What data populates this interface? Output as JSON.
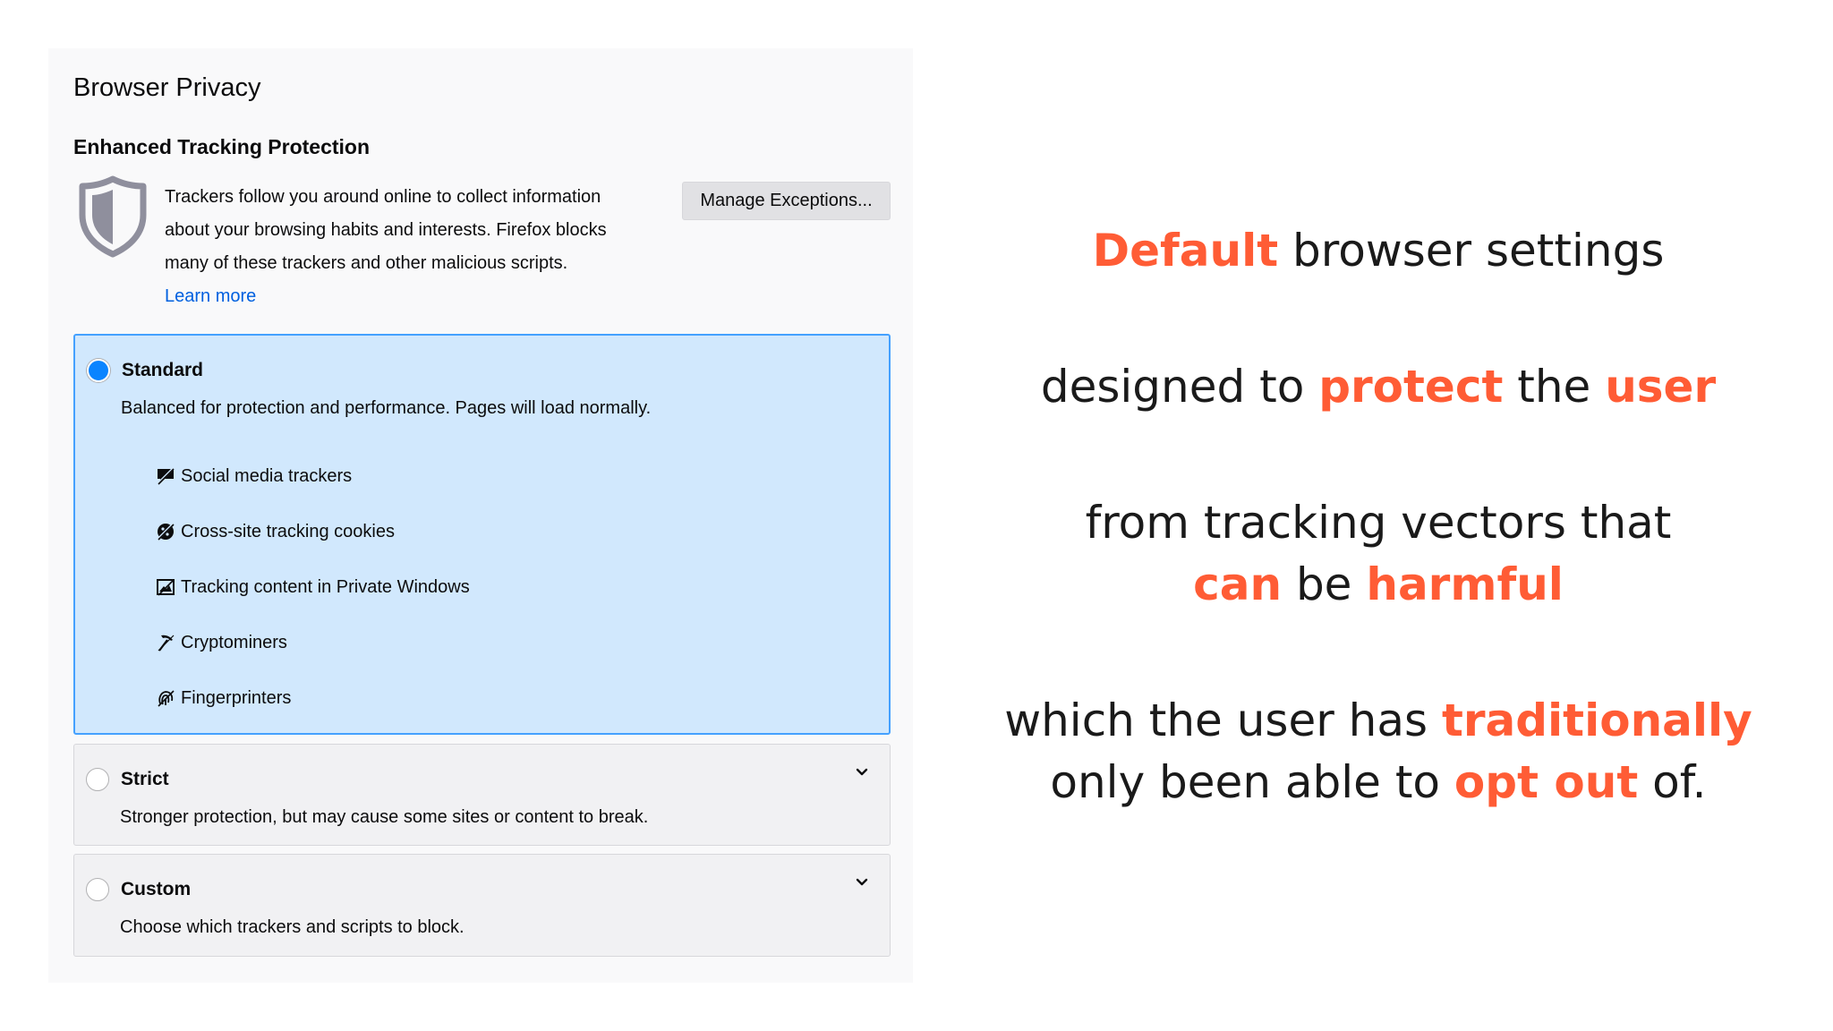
{
  "panel": {
    "title": "Browser Privacy",
    "etp_heading": "Enhanced Tracking Protection",
    "description_lines": [
      "Trackers follow you around online to collect information",
      "about your browsing habits and interests. Firefox blocks",
      "many of these trackers and other malicious scripts."
    ],
    "learn_more": "Learn more",
    "manage_exceptions": "Manage Exceptions..."
  },
  "options": {
    "standard": {
      "label": "Standard",
      "description": "Balanced for protection and performance. Pages will load normally.",
      "selected": true,
      "trackers": [
        {
          "label": "Social media trackers",
          "icon": "social-media-tracker-icon"
        },
        {
          "label": "Cross-site tracking cookies",
          "icon": "cookie-icon"
        },
        {
          "label": "Tracking content in Private Windows",
          "icon": "tracking-content-icon"
        },
        {
          "label": "Cryptominers",
          "icon": "cryptominer-icon"
        },
        {
          "label": "Fingerprinters",
          "icon": "fingerprinter-icon"
        }
      ]
    },
    "strict": {
      "label": "Strict",
      "description": "Stronger protection, but may cause some sites or content to break."
    },
    "custom": {
      "label": "Custom",
      "description": "Choose which trackers and scripts to block."
    }
  },
  "slide": {
    "line1": [
      {
        "t": "Default",
        "h": true
      },
      {
        "t": " browser settings",
        "h": false
      }
    ],
    "line2": [
      {
        "t": "designed to ",
        "h": false
      },
      {
        "t": "protect",
        "h": true
      },
      {
        "t": " the ",
        "h": false
      },
      {
        "t": "user",
        "h": true
      }
    ],
    "line3": [
      {
        "t": "from tracking vectors that",
        "h": false
      }
    ],
    "line4": [
      {
        "t": "can",
        "h": true
      },
      {
        "t": " be ",
        "h": false
      },
      {
        "t": "harmful",
        "h": true
      }
    ],
    "line5": [
      {
        "t": "which the user has ",
        "h": false
      },
      {
        "t": "traditionally",
        "h": true
      }
    ],
    "line6": [
      {
        "t": "only been able to ",
        "h": false
      },
      {
        "t": "opt out",
        "h": true
      },
      {
        "t": " of.",
        "h": false
      }
    ]
  },
  "colors": {
    "highlight": "#ff5c35",
    "selected_bg": "#d1e8fd",
    "selected_border": "#45a1ff",
    "link": "#0060df",
    "radio_checked": "#0a84ff"
  }
}
